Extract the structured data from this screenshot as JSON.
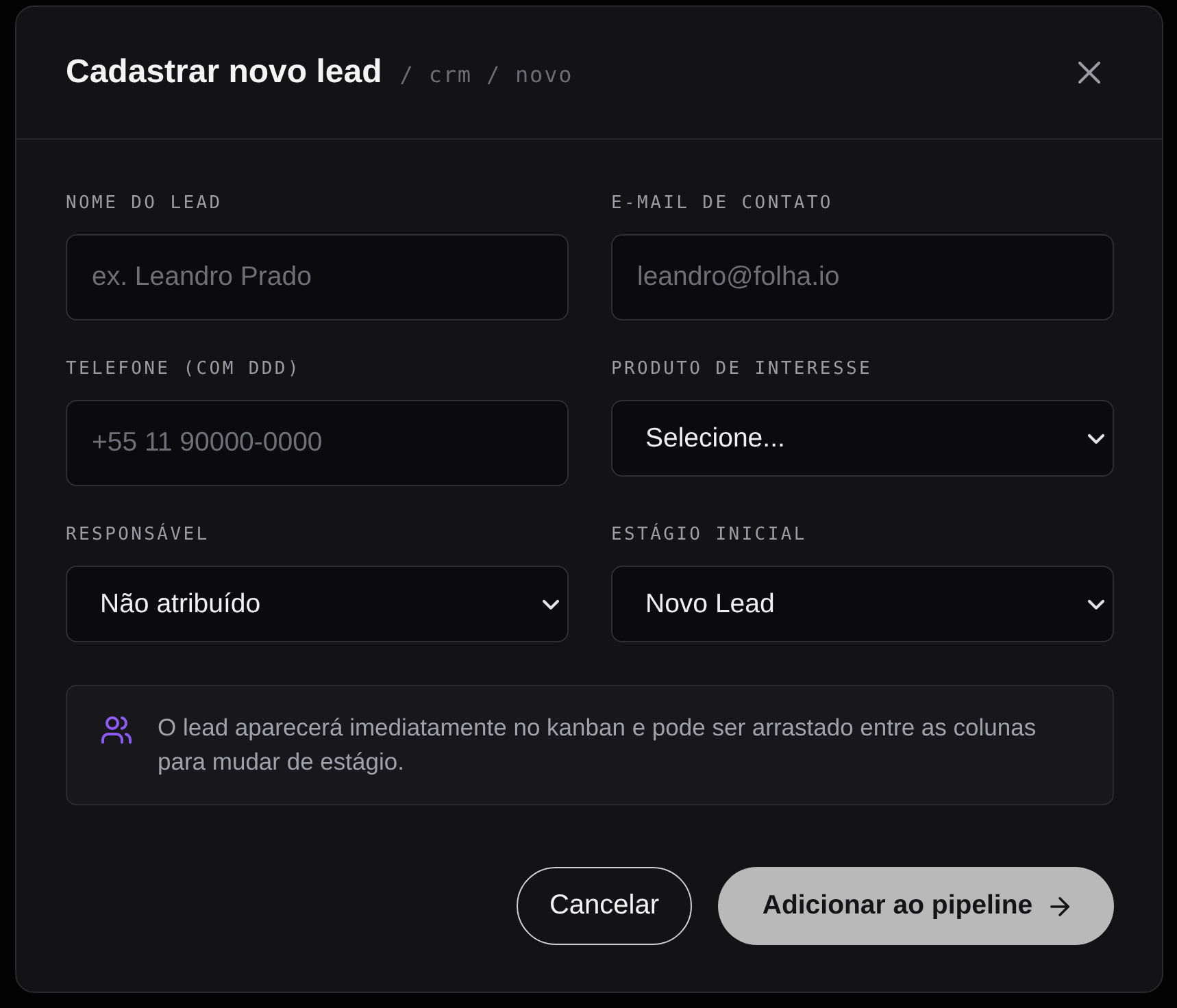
{
  "dialog": {
    "title": "Cadastrar novo lead",
    "breadcrumb": "/ crm / novo"
  },
  "fields": [
    {
      "kind": "text",
      "label": "NOME DO LEAD",
      "placeholder": "ex. Leandro Prado"
    },
    {
      "kind": "text",
      "label": "E-MAIL DE CONTATO",
      "placeholder": "leandro@folha.io"
    },
    {
      "kind": "text",
      "label": "TELEFONE (COM DDD)",
      "placeholder": "+55 11 90000-0000"
    },
    {
      "kind": "select",
      "label": "PRODUTO DE INTERESSE",
      "value": "Selecione..."
    },
    {
      "kind": "select",
      "label": "RESPONSÁVEL",
      "value": "Não atribuído"
    },
    {
      "kind": "select",
      "label": "ESTÁGIO INICIAL",
      "value": "Novo Lead"
    }
  ],
  "notice": {
    "text": "O lead aparecerá imediatamente no kanban e pode ser arrastado entre as colunas para mudar de estágio."
  },
  "buttons": [
    {
      "kind": "secondary",
      "label": "Cancelar"
    },
    {
      "kind": "primary",
      "label": "Adicionar ao pipeline"
    }
  ]
}
